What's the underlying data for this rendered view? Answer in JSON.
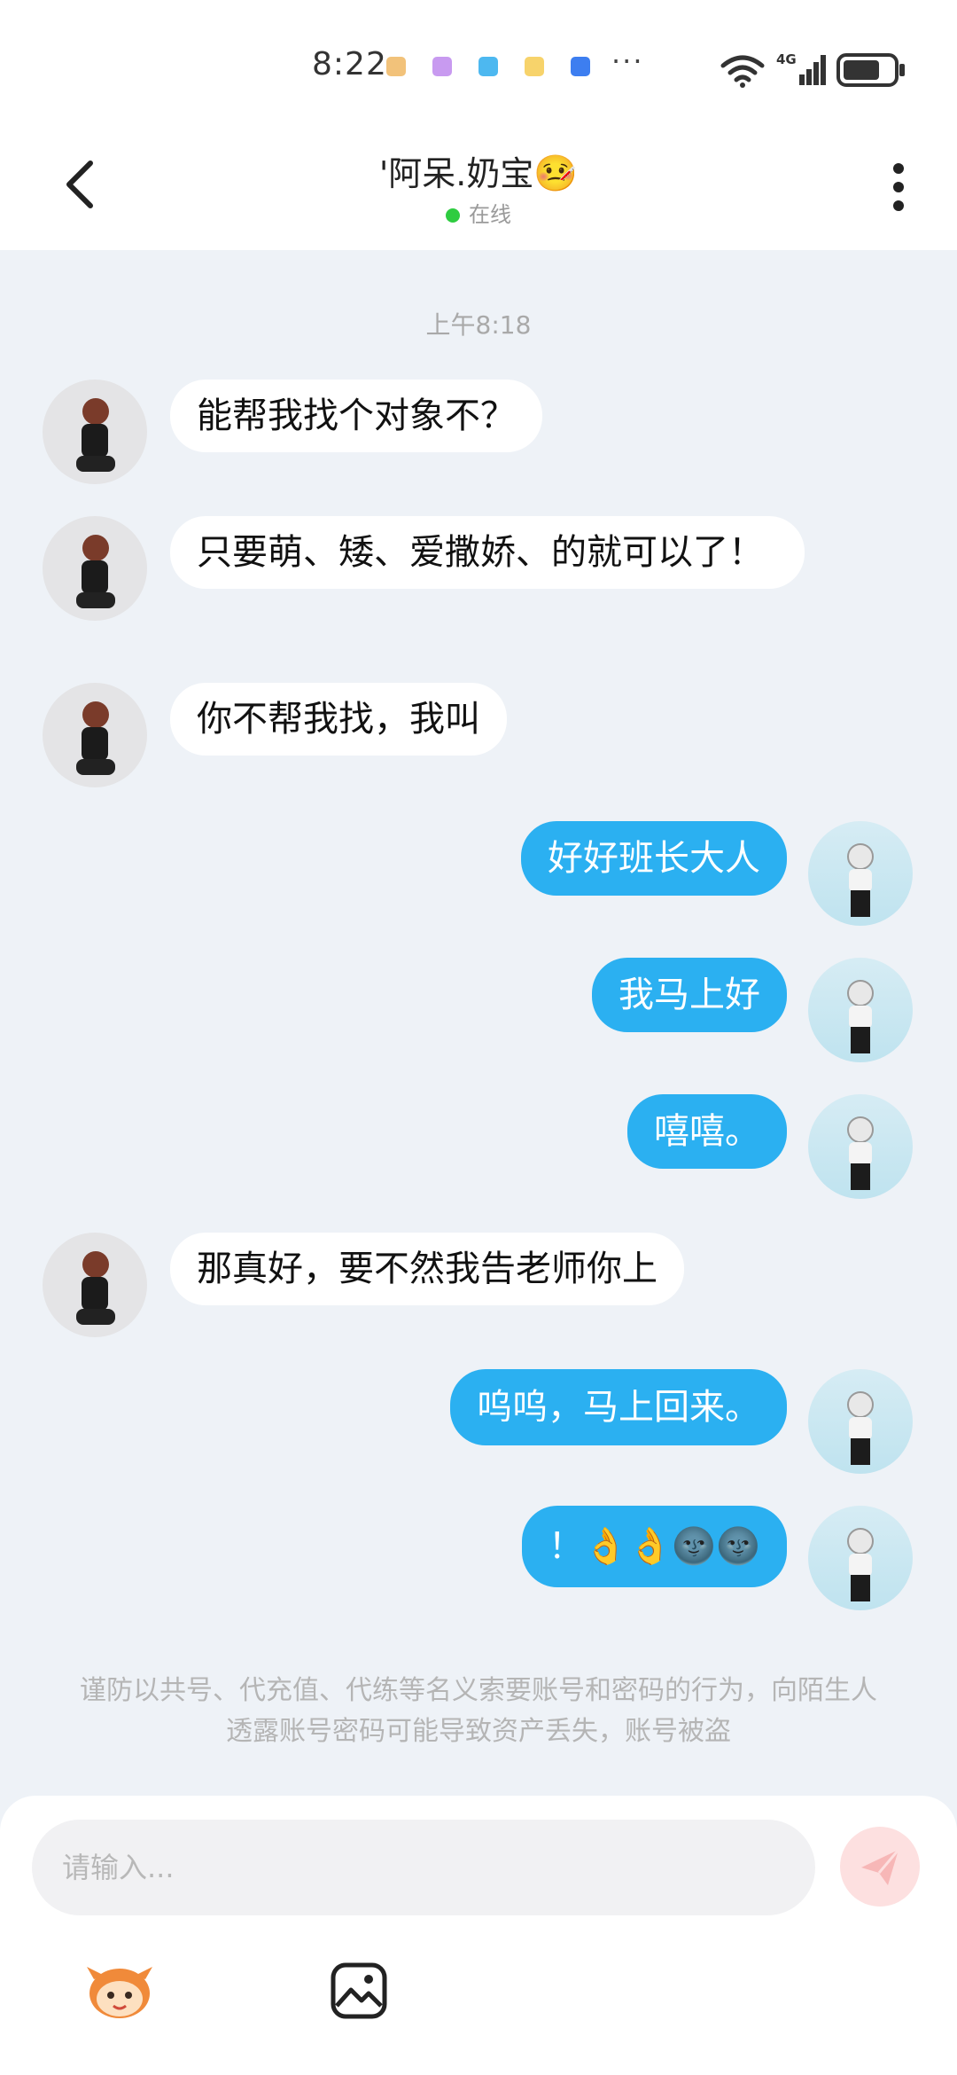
{
  "status_bar": {
    "time": "8:22",
    "notification_colors": [
      "#f2c27a",
      "#c89af0",
      "#4db8f0",
      "#f7d36b",
      "#3d7ef0"
    ],
    "network": "4G"
  },
  "header": {
    "title": "'阿呆.奶宝",
    "title_emoji": "🤒",
    "status": "在线",
    "status_color": "#2ecc40"
  },
  "chat": {
    "timestamp": "上午8:18",
    "messages": [
      {
        "side": "in",
        "text": "能帮我找个对象不？"
      },
      {
        "side": "in",
        "text": "只要萌、矮、爱撒娇、的就可以了！"
      },
      {
        "side": "in",
        "text": "你不帮我找，我叫"
      },
      {
        "side": "out",
        "text": "好好班长大人"
      },
      {
        "side": "out",
        "text": "我马上好"
      },
      {
        "side": "out",
        "text": "嘻嘻。"
      },
      {
        "side": "in",
        "text": "那真好，要不然我告老师你上"
      },
      {
        "side": "out",
        "text": "呜呜，马上回来。"
      },
      {
        "side": "out",
        "text": "！👌👌🌚🌚"
      }
    ],
    "colors": {
      "incoming": "#ffffff",
      "outgoing": "#2bb0f1"
    }
  },
  "warning": "谨防以共号、代充值、代练等名义索要账号和密码的行为，向陌生人透露账号密码可能导致资产丢失，账号被盗",
  "input": {
    "placeholder": "请输入..."
  }
}
